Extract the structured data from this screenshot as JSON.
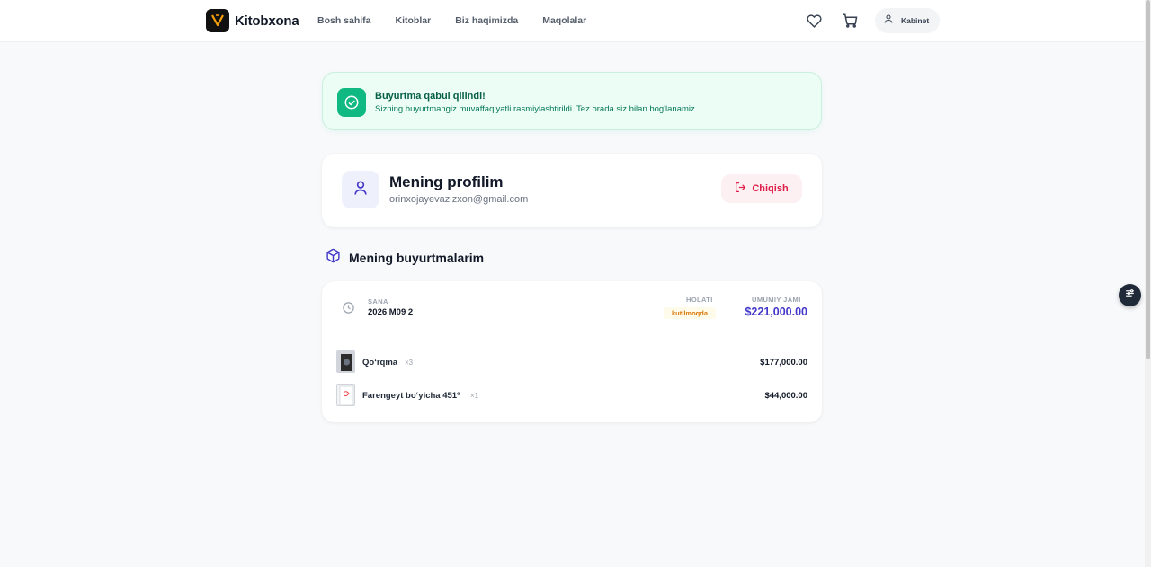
{
  "header": {
    "brand": "Kitobxona",
    "nav": [
      "Bosh sahifa",
      "Kitoblar",
      "Biz haqimizda",
      "Maqolalar"
    ],
    "cabinet_label": "Kabinet"
  },
  "success": {
    "title": "Buyurtma qabul qilindi!",
    "message": "Sizning buyurtmangiz muvaffaqiyatli rasmiylashtirildi. Tez orada siz bilan bog'lanamiz."
  },
  "profile": {
    "title": "Mening profilim",
    "email": "orinxojayevazizxon@gmail.com",
    "logout_label": "Chiqish"
  },
  "orders": {
    "title": "Mening buyurtmalarim",
    "list": [
      {
        "date_label": "SANA",
        "date": "2026 M09 2",
        "status_label": "HOLATI",
        "status": "kutilmoqda",
        "total_label": "UMUMIY JAMI",
        "total": "$221,000.00",
        "items": [
          {
            "name": "Qo‘rqma",
            "qty": "×3",
            "price": "$177,000.00"
          },
          {
            "name": "Farengeyt bo‘yicha 451º",
            "qty": "×1",
            "price": "$44,000.00"
          }
        ]
      }
    ]
  },
  "colors": {
    "accent": "#4338ca",
    "success": "#10b981",
    "danger": "#e11d48",
    "warning": "#d97706"
  },
  "icons": [
    "logo-icon",
    "heart-icon",
    "cart-icon",
    "user-icon",
    "check-circle-icon",
    "logout-icon",
    "package-icon",
    "clock-icon",
    "filter-icon"
  ]
}
